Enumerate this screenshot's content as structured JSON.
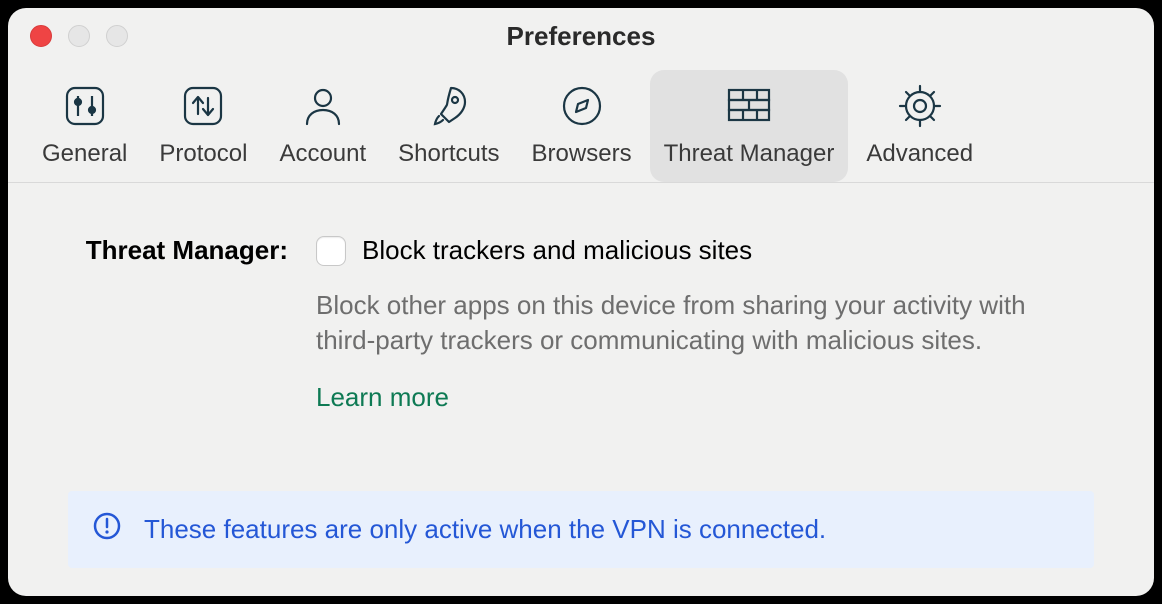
{
  "window": {
    "title": "Preferences"
  },
  "tabs": [
    {
      "id": "general",
      "label": "General"
    },
    {
      "id": "protocol",
      "label": "Protocol"
    },
    {
      "id": "account",
      "label": "Account"
    },
    {
      "id": "shortcuts",
      "label": "Shortcuts"
    },
    {
      "id": "browsers",
      "label": "Browsers"
    },
    {
      "id": "threat-manager",
      "label": "Threat Manager",
      "active": true
    },
    {
      "id": "advanced",
      "label": "Advanced"
    }
  ],
  "threat_manager": {
    "section_label": "Threat Manager:",
    "checkbox_label": "Block trackers and malicious sites",
    "checkbox_checked": false,
    "description": "Block other apps on this device from sharing your activity with third-party trackers or communicating with malicious sites.",
    "learn_more": "Learn more"
  },
  "info_banner": {
    "text": "These features are only active when the VPN is connected."
  }
}
